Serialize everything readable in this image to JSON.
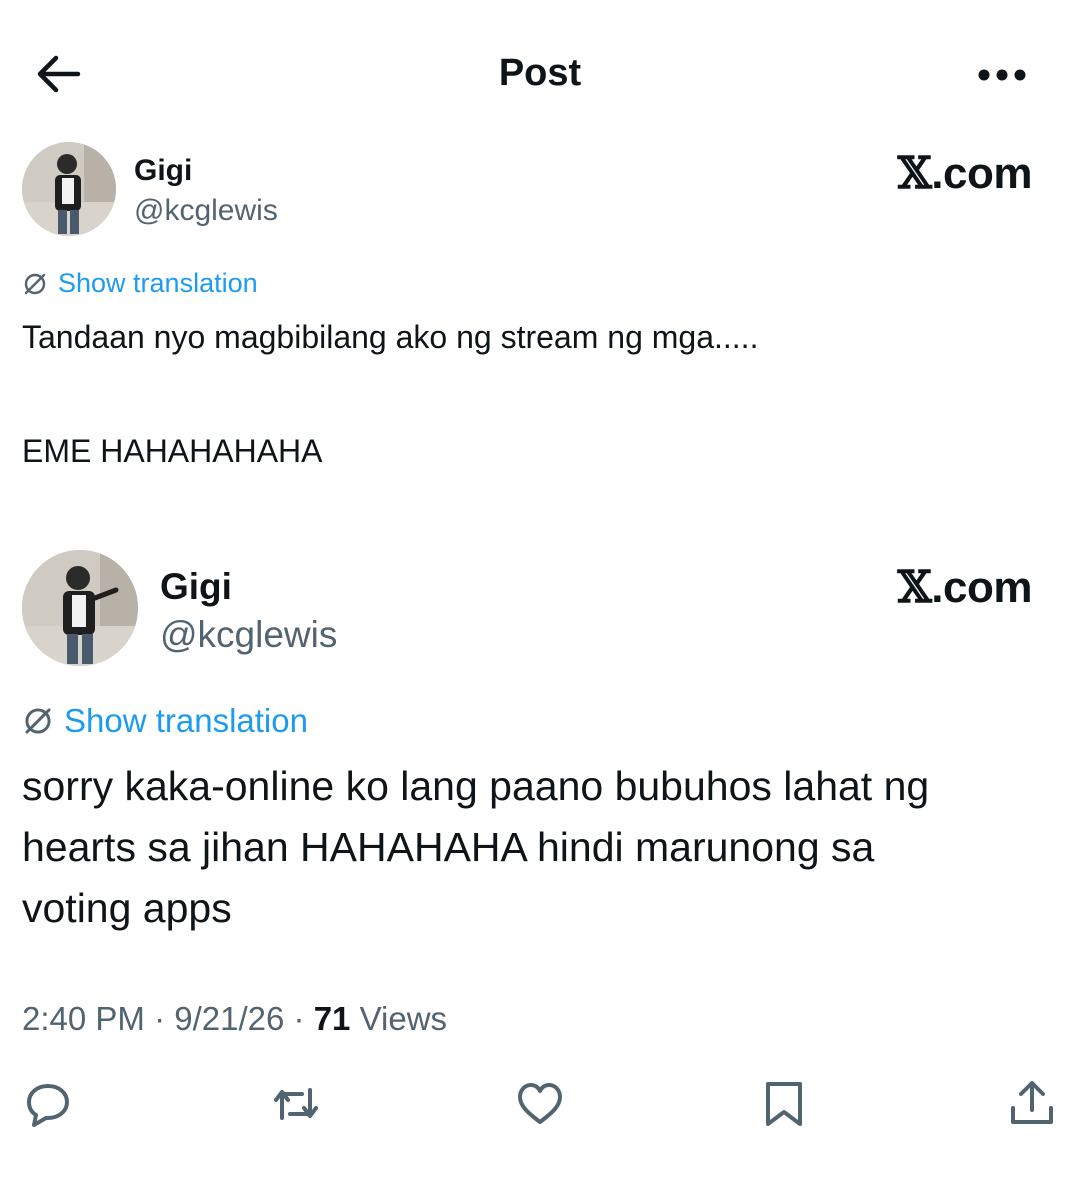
{
  "header": {
    "title": "Post"
  },
  "posts": [
    {
      "name": "Gigi",
      "handle": "@kcglewis",
      "brand_x": "𝕏",
      "brand_rest": ".com",
      "translation_label": "Show translation",
      "text": "Tandaan nyo magbibilang ako ng stream ng mga.....\n\n\nEME HAHAHAHAHA"
    },
    {
      "name": "Gigi",
      "handle": "@kcglewis",
      "brand_x": "𝕏",
      "brand_rest": ".com",
      "translation_label": "Show translation",
      "text": "sorry kaka-online ko lang paano bubuhos lahat ng\nhearts sa jihan HAHAHAHA hindi marunong sa\nvoting apps"
    }
  ],
  "meta": {
    "time": "2:40 PM",
    "separator": "·",
    "date": "9/21/26",
    "views_count": "71",
    "views_label": "Views"
  },
  "actions": [
    "reply-icon",
    "repost-icon",
    "like-icon",
    "bookmark-icon",
    "share-icon"
  ],
  "colors": {
    "accent": "#1d9bf0",
    "text": "#0f1419",
    "muted": "#536471"
  }
}
